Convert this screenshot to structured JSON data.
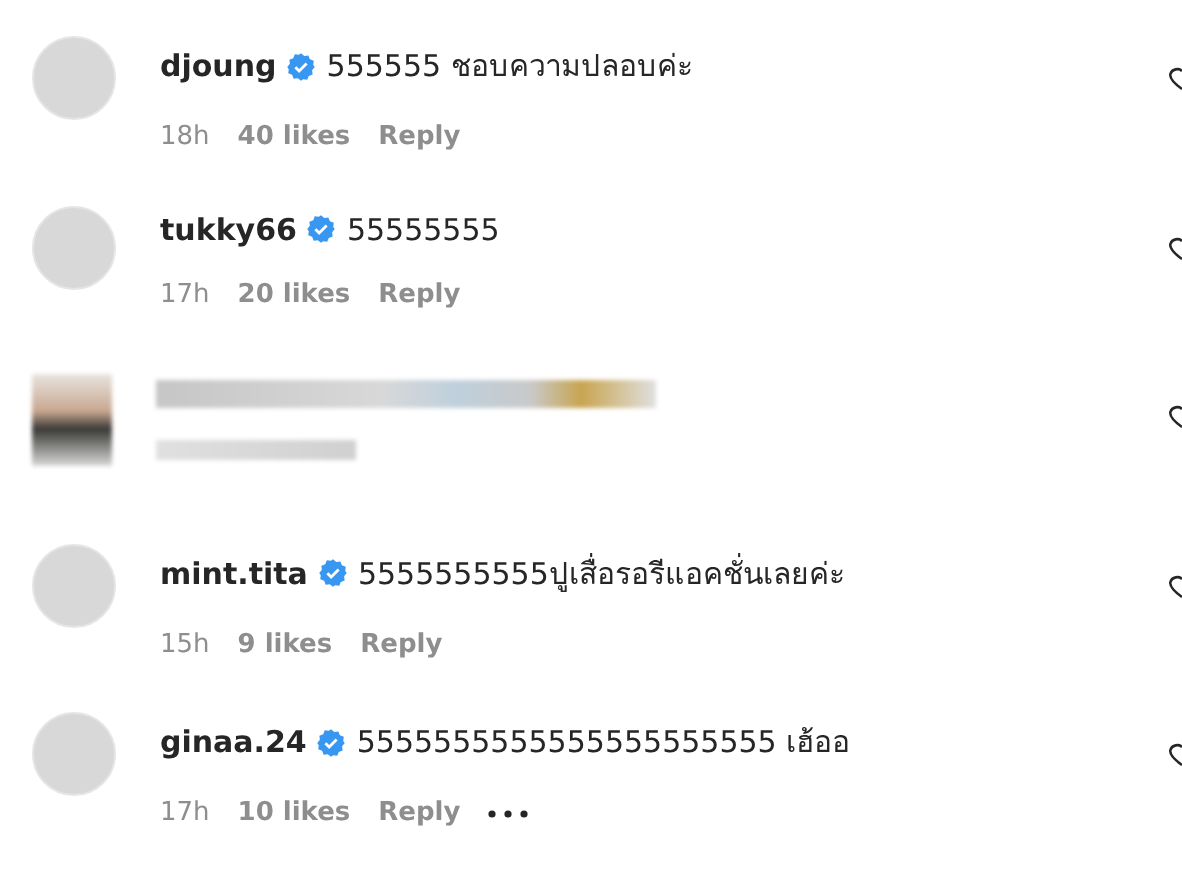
{
  "comments": [
    {
      "kind": "comment",
      "username": "djoung",
      "verified": true,
      "text": "555555 ชอบความปลอบค่ะ",
      "time": "18h",
      "likes": "40 likes",
      "reply": "Reply",
      "more": false
    },
    {
      "kind": "comment",
      "username": "tukky66",
      "verified": true,
      "text": "55555555",
      "time": "17h",
      "likes": "20 likes",
      "reply": "Reply",
      "more": false
    },
    {
      "kind": "redacted"
    },
    {
      "kind": "comment",
      "username": "mint.tita",
      "verified": true,
      "text": "5555555555ปูเสื่อรอรีแอคชั่นเลยค่ะ",
      "time": "15h",
      "likes": "9 likes",
      "reply": "Reply",
      "more": false
    },
    {
      "kind": "comment",
      "username": "ginaa.24",
      "verified": true,
      "text": "5555555555555555555555 เฮ้ออ",
      "time": "17h",
      "likes": "10 likes",
      "reply": "Reply",
      "more": true
    }
  ]
}
